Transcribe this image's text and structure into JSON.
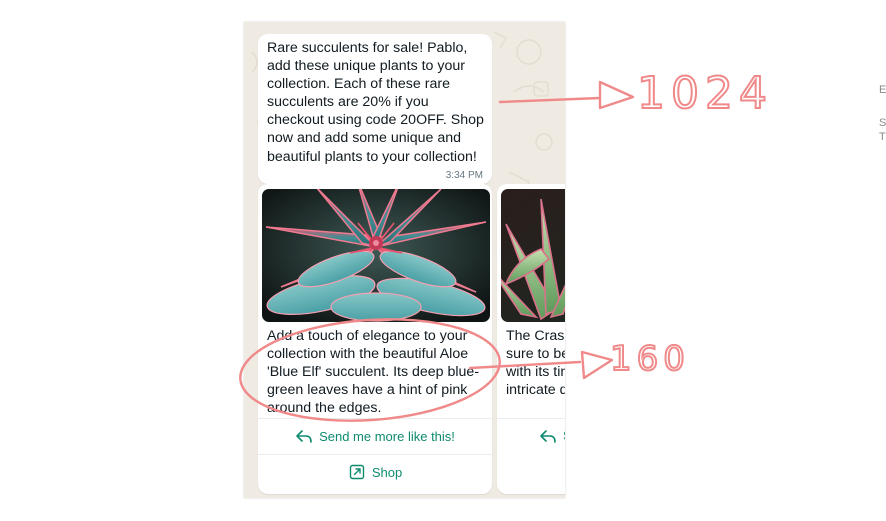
{
  "message": {
    "text": "Rare succulents for sale! Pablo,\nadd these unique plants to your\ncollection. Each of these rare\nsucculents are 20% if you\ncheckout using code 20OFF. Shop\nnow and add some unique and\nbeautiful plants to your collection!",
    "time": "3:34 PM"
  },
  "cards": [
    {
      "body": "Add a touch of elegance to your\ncollection with the beautiful Aloe\n'Blue Elf' succulent. Its deep blue-\ngreen leaves have a hint of pink\naround the edges.",
      "reply_button": "Send me more like this!",
      "cta_button": "Shop"
    },
    {
      "body": "The Crass\nsure to be\nwith its tin\nintricate d",
      "reply_button": "S"
    }
  ],
  "annotations": {
    "top_label": "1024",
    "bottom_label": "160"
  },
  "right_edge_text": [
    "E",
    "S",
    "T"
  ],
  "colors": {
    "chat_background": "#efeae2",
    "accent_green": "#0e8b6e",
    "timestamp": "#667781",
    "annotation_red": "#f08a8a"
  },
  "icons": {
    "reply": "reply-arrow-icon",
    "cta": "external-link-icon"
  }
}
